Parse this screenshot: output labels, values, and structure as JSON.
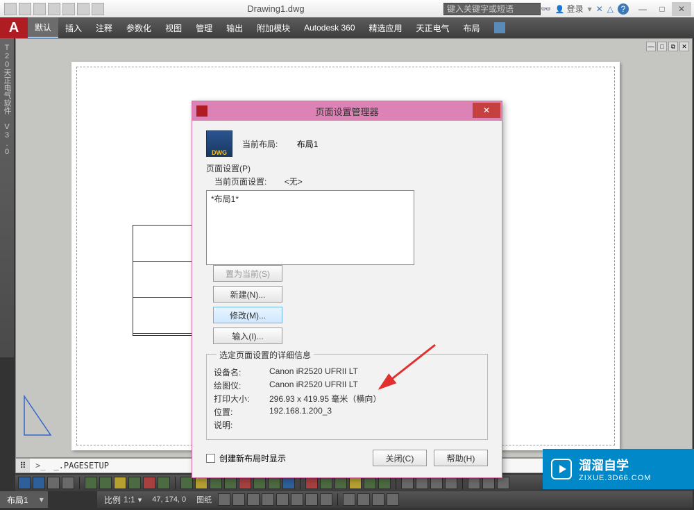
{
  "title": "Drawing1.dwg",
  "search_placeholder": "键入关键字或短语",
  "login_label": "登录",
  "tabs": [
    "默认",
    "插入",
    "注释",
    "参数化",
    "视图",
    "管理",
    "输出",
    "附加模块",
    "Autodesk 360",
    "精选应用",
    "天正电气",
    "布局"
  ],
  "active_tab": "默认",
  "sidebar_title": "T20天正电气软件 V3.0",
  "viewctrls": [
    "―",
    "□",
    "⧉",
    "✕"
  ],
  "cmd_text": "_.PAGESETUP",
  "cmd_prefix": ">_",
  "layout_tab": "布局1",
  "status": {
    "scale_label": "比例",
    "scale_value": "1:1",
    "coords": "47, 174, 0",
    "paper_label": "图纸"
  },
  "dialog": {
    "title": "页面设置管理器",
    "current_layout_label": "当前布局:",
    "current_layout_value": "布局1",
    "section_header": "页面设置(P)",
    "current_setup_label": "当前页面设置:",
    "current_setup_value": "<无>",
    "list_items": [
      "*布局1*"
    ],
    "buttons": {
      "set_current": "置为当前(S)",
      "new": "新建(N)...",
      "modify": "修改(M)...",
      "import": "输入(I)..."
    },
    "details_title": "选定页面设置的详细信息",
    "details": {
      "device_k": "设备名:",
      "device_v": "Canon iR2520 UFRII LT",
      "plotter_k": "绘图仪:",
      "plotter_v": "Canon iR2520 UFRII LT",
      "size_k": "打印大小:",
      "size_v": "296.93 x 419.95 毫米（横向）",
      "loc_k": "位置:",
      "loc_v": "192.168.1.200_3",
      "desc_k": "说明:",
      "desc_v": ""
    },
    "checkbox_label": "创建新布局时显示",
    "close_btn": "关闭(C)",
    "help_btn": "帮助(H)"
  },
  "badge": {
    "title": "溜溜自学",
    "sub": "ZIXUE.3D66.COM"
  },
  "dwg_icon_text": "DWG"
}
